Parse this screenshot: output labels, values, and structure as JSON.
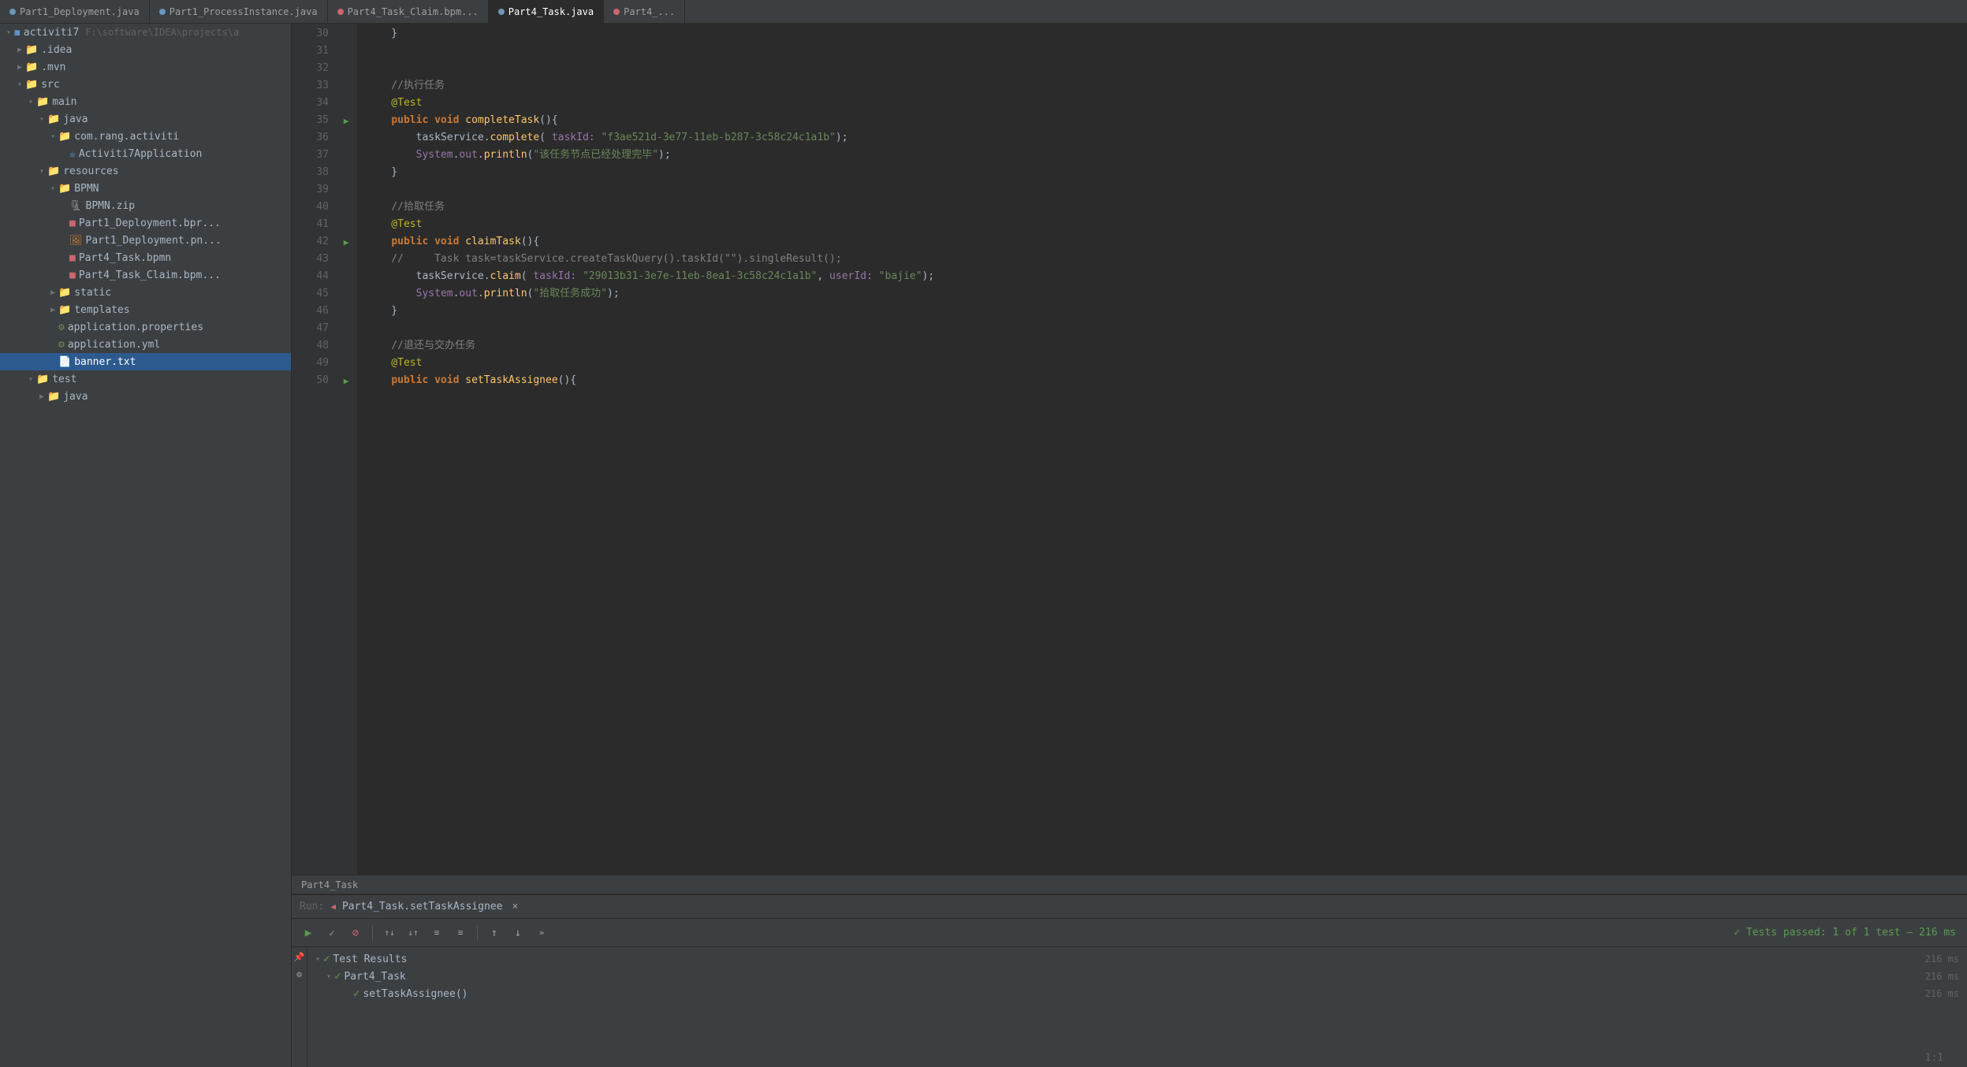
{
  "tabs": [
    {
      "id": "part1-deploy",
      "label": "Part1_Deployment.java",
      "color": "blue",
      "active": false
    },
    {
      "id": "part1-proc",
      "label": "Part1_ProcessInstance.java",
      "color": "blue",
      "active": false
    },
    {
      "id": "part4-task-claim",
      "label": "Part4_Task_Claim.bpm...",
      "color": "red",
      "active": false
    },
    {
      "id": "part4-task",
      "label": "Part4_Task.java",
      "color": "blue",
      "active": true
    },
    {
      "id": "part4-x",
      "label": "Part4_...",
      "color": "red",
      "active": false
    }
  ],
  "sidebar": {
    "project_label": "activiti7",
    "project_path": "F:\\software\\IDEA\\projects\\a",
    "items": [
      {
        "id": "idea",
        "label": ".idea",
        "indent": 1,
        "type": "folder",
        "expanded": false
      },
      {
        "id": "mvn",
        "label": ".mvn",
        "indent": 1,
        "type": "folder",
        "expanded": false
      },
      {
        "id": "src",
        "label": "src",
        "indent": 1,
        "type": "folder",
        "expanded": true
      },
      {
        "id": "main",
        "label": "main",
        "indent": 2,
        "type": "folder",
        "expanded": true
      },
      {
        "id": "java",
        "label": "java",
        "indent": 3,
        "type": "folder",
        "expanded": true
      },
      {
        "id": "com-rang",
        "label": "com.rang.activiti",
        "indent": 4,
        "type": "folder",
        "expanded": true
      },
      {
        "id": "activiti7app",
        "label": "Activiti7Application",
        "indent": 5,
        "type": "java",
        "expanded": false
      },
      {
        "id": "resources",
        "label": "resources",
        "indent": 3,
        "type": "folder",
        "expanded": true
      },
      {
        "id": "bpmn",
        "label": "BPMN",
        "indent": 4,
        "type": "folder",
        "expanded": true
      },
      {
        "id": "bpmn-zip",
        "label": "BPMN.zip",
        "indent": 5,
        "type": "zip",
        "expanded": false
      },
      {
        "id": "part1-deploy-bpmn",
        "label": "Part1_Deployment.bpr...",
        "indent": 5,
        "type": "bpmn-red",
        "expanded": false
      },
      {
        "id": "part1-deploy-png",
        "label": "Part1_Deployment.pn...",
        "indent": 5,
        "type": "png",
        "expanded": false
      },
      {
        "id": "part4-task-bpmn",
        "label": "Part4_Task.bpmn",
        "indent": 5,
        "type": "bpmn-red",
        "expanded": false
      },
      {
        "id": "part4-task-claim-bpmn",
        "label": "Part4_Task_Claim.bpm...",
        "indent": 5,
        "type": "bpmn-red",
        "expanded": false
      },
      {
        "id": "static",
        "label": "static",
        "indent": 4,
        "type": "folder",
        "expanded": false
      },
      {
        "id": "templates",
        "label": "templates",
        "indent": 4,
        "type": "folder",
        "expanded": false
      },
      {
        "id": "app-props",
        "label": "application.properties",
        "indent": 4,
        "type": "props",
        "expanded": false
      },
      {
        "id": "app-yml",
        "label": "application.yml",
        "indent": 4,
        "type": "yml",
        "expanded": false
      },
      {
        "id": "banner",
        "label": "banner.txt",
        "indent": 4,
        "type": "txt",
        "selected": true,
        "expanded": false
      },
      {
        "id": "test",
        "label": "test",
        "indent": 2,
        "type": "folder",
        "expanded": true
      },
      {
        "id": "test-java",
        "label": "java",
        "indent": 3,
        "type": "folder",
        "expanded": false
      }
    ]
  },
  "code": {
    "lines": [
      {
        "num": 30,
        "gutter": "",
        "text": "    }"
      },
      {
        "num": 31,
        "gutter": "",
        "text": ""
      },
      {
        "num": 32,
        "gutter": "",
        "text": ""
      },
      {
        "num": 33,
        "gutter": "",
        "text": "    //执行任务",
        "type": "comment"
      },
      {
        "num": 34,
        "gutter": "",
        "text": "    @Test",
        "type": "annotation"
      },
      {
        "num": 35,
        "gutter": "run",
        "text": "    public void completeTask(){",
        "type": "method"
      },
      {
        "num": 36,
        "gutter": "",
        "text": "        taskService.complete( taskId: \"f3ae521d-3e77-11eb-b287-3c58c24c1a1b\");"
      },
      {
        "num": 37,
        "gutter": "",
        "text": "        System.out.println(\"该任务节点已经处理完毕\");"
      },
      {
        "num": 38,
        "gutter": "",
        "text": "    }"
      },
      {
        "num": 39,
        "gutter": "",
        "text": ""
      },
      {
        "num": 40,
        "gutter": "",
        "text": "    //拾取任务",
        "type": "comment"
      },
      {
        "num": 41,
        "gutter": "",
        "text": "    @Test",
        "type": "annotation"
      },
      {
        "num": 42,
        "gutter": "run",
        "text": "    public void claimTask(){",
        "type": "method"
      },
      {
        "num": 43,
        "gutter": "",
        "text": "    //     Task task=taskService.createTaskQuery().taskId(\"\").singleResult();"
      },
      {
        "num": 44,
        "gutter": "",
        "text": "        taskService.claim( taskId: \"29013b31-3e7e-11eb-8ea1-3c58c24c1a1b\", userId: \"bajie\");"
      },
      {
        "num": 45,
        "gutter": "",
        "text": "        System.out.println(\"拾取任务成功\");"
      },
      {
        "num": 46,
        "gutter": "",
        "text": "    }"
      },
      {
        "num": 47,
        "gutter": "",
        "text": ""
      },
      {
        "num": 48,
        "gutter": "",
        "text": "    //退还与交办任务",
        "type": "comment"
      },
      {
        "num": 49,
        "gutter": "",
        "text": "    @Test",
        "type": "annotation"
      },
      {
        "num": 50,
        "gutter": "run",
        "text": "    public void setTaskAssignee(){",
        "type": "method"
      }
    ],
    "breadcrumb": "Part4_Task"
  },
  "run_panel": {
    "title": "Run:",
    "test_name": "Part4_Task.setTaskAssignee",
    "close_label": "×",
    "status_msg": "Tests passed: 1 of 1 test – 216 ms",
    "test_results_label": "Test Results",
    "test_results_time": "216 ms",
    "part4_task_label": "Part4_Task",
    "part4_task_time": "216 ms",
    "set_task_assignee_label": "setTaskAssignee()",
    "set_task_assignee_time": "216 ms"
  },
  "colors": {
    "bg": "#2b2b2b",
    "sidebar_bg": "#3c3f41",
    "selected_bg": "#2d5a8e",
    "active_tab_bg": "#2b2b2b",
    "inactive_tab_bg": "#3c3f41",
    "green": "#5b9b4f",
    "red": "#cc666e",
    "blue_tab": "#6897bb"
  },
  "cursor_position": "1:1"
}
